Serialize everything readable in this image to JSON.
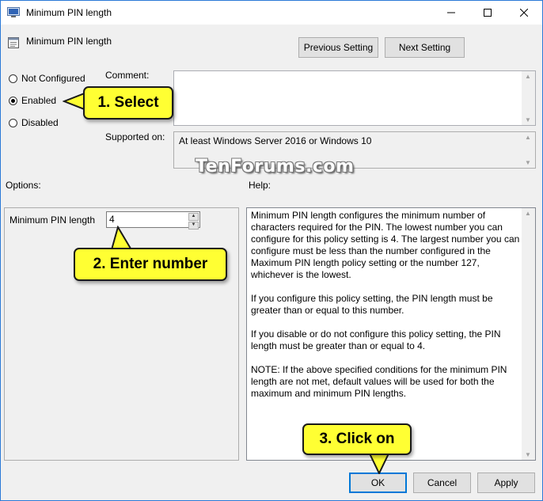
{
  "window": {
    "title": "Minimum PIN length"
  },
  "header": {
    "setting_name": "Minimum PIN length",
    "previous_label": "Previous Setting",
    "next_label": "Next Setting"
  },
  "state": {
    "options": [
      "Not Configured",
      "Enabled",
      "Disabled"
    ],
    "selected": "Enabled"
  },
  "comment": {
    "label": "Comment:",
    "value": ""
  },
  "supported": {
    "label": "Supported on:",
    "value": "At least Windows Server 2016 or Windows 10"
  },
  "options_label": "Options:",
  "help_label": "Help:",
  "option_field": {
    "label": "Minimum PIN length",
    "value": "4"
  },
  "help": {
    "paragraphs": [
      "Minimum PIN length configures the minimum number of characters required for the PIN.  The lowest number you can configure for this policy setting is 4.  The largest number you can configure must be less than the number configured in the Maximum PIN length policy setting or the number 127, whichever is the lowest.",
      "If you configure this policy setting, the PIN length must be greater than or equal to this number.",
      "If you disable or do not configure this policy setting, the PIN length must be greater than or equal to 4.",
      "NOTE: If the above specified conditions for the minimum PIN length are not met, default values will be used for both the maximum and minimum PIN lengths."
    ]
  },
  "footer": {
    "ok_label": "OK",
    "cancel_label": "Cancel",
    "apply_label": "Apply"
  },
  "callouts": {
    "step1": "1. Select",
    "step2": "2. Enter number",
    "step3": "3. Click on"
  },
  "watermark": "TenForums.com",
  "colors": {
    "callout": "#ffff33",
    "accent": "#0078d7"
  }
}
